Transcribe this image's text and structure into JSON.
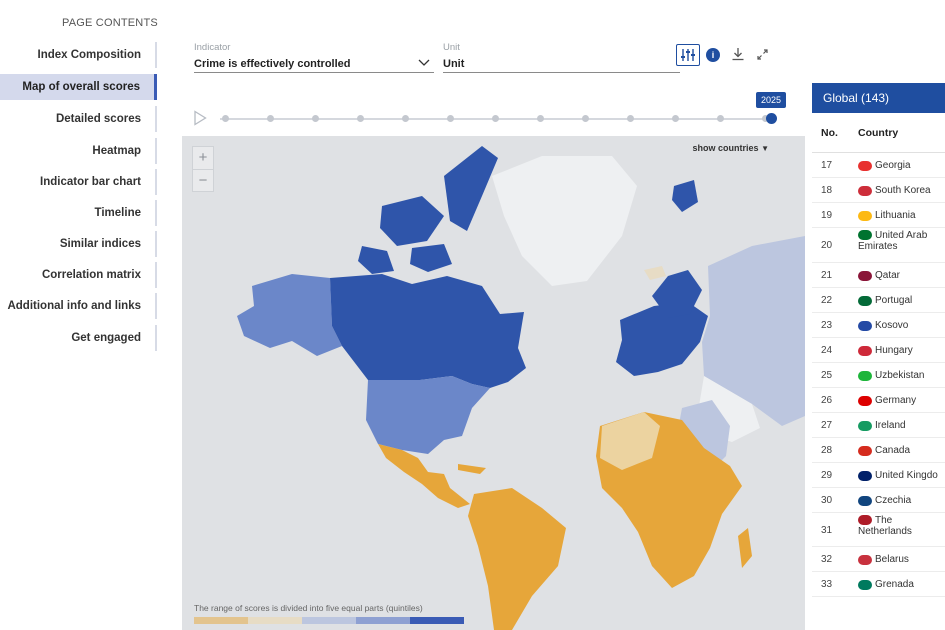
{
  "sidebar": {
    "heading": "PAGE CONTENTS",
    "items": [
      {
        "label": "Index Composition"
      },
      {
        "label": "Map of overall scores"
      },
      {
        "label": "Detailed scores"
      },
      {
        "label": "Heatmap"
      },
      {
        "label": "Indicator bar chart"
      },
      {
        "label": "Timeline"
      },
      {
        "label": "Similar indices"
      },
      {
        "label": "Correlation matrix"
      },
      {
        "label": "Additional info and links"
      },
      {
        "label": "Get engaged"
      }
    ],
    "active_index": 1
  },
  "controls": {
    "indicator_label": "Indicator",
    "indicator_value": "Crime is effectively controlled",
    "unit_label": "Unit",
    "unit_value": "Unit"
  },
  "toolbar": {
    "icons": [
      "settings-sliders-icon",
      "info-icon",
      "download-icon",
      "expand-icon"
    ]
  },
  "timeline": {
    "year": "2025",
    "ticks": 13
  },
  "map": {
    "zoom_in": "+",
    "zoom_out": "−",
    "show_countries": "show countries",
    "legend_text": "The range of scores is divided into five equal parts (quintiles)",
    "legend_colors": [
      "#e3c48e",
      "#e7dcc5",
      "#bcc6df",
      "#8ea0d2",
      "#3a5bb5"
    ]
  },
  "ranking": {
    "header": "Global (143)",
    "col_no": "No.",
    "col_country": "Country",
    "rows": [
      {
        "no": "17",
        "country": "Georgia",
        "flag": "#e8312f"
      },
      {
        "no": "18",
        "country": "South Korea",
        "flag": "#cd2e3a"
      },
      {
        "no": "19",
        "country": "Lithuania",
        "flag": "#fdb913"
      },
      {
        "no": "20",
        "country": "United Arab Emirates",
        "flag": "#00732f"
      },
      {
        "no": "21",
        "country": "Qatar",
        "flag": "#8a1538"
      },
      {
        "no": "22",
        "country": "Portugal",
        "flag": "#046a38"
      },
      {
        "no": "23",
        "country": "Kosovo",
        "flag": "#244aa5"
      },
      {
        "no": "24",
        "country": "Hungary",
        "flag": "#ce2939"
      },
      {
        "no": "25",
        "country": "Uzbekistan",
        "flag": "#1eb53a"
      },
      {
        "no": "26",
        "country": "Germany",
        "flag": "#dd0000"
      },
      {
        "no": "27",
        "country": "Ireland",
        "flag": "#169b62"
      },
      {
        "no": "28",
        "country": "Canada",
        "flag": "#d52b1e"
      },
      {
        "no": "29",
        "country": "United Kingdo",
        "flag": "#012169"
      },
      {
        "no": "30",
        "country": "Czechia",
        "flag": "#11457e"
      },
      {
        "no": "31",
        "country": "The Netherlands",
        "flag": "#ae1c28"
      },
      {
        "no": "32",
        "country": "Belarus",
        "flag": "#c8313e"
      },
      {
        "no": "33",
        "country": "Grenada",
        "flag": "#007a5e"
      }
    ]
  }
}
